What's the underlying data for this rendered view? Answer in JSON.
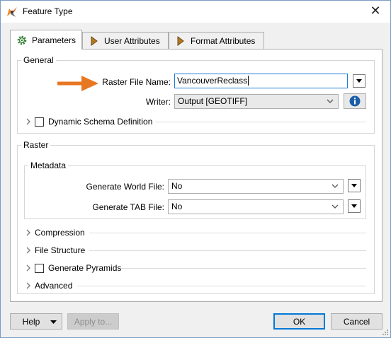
{
  "window": {
    "title": "Feature Type",
    "close_label": "✕"
  },
  "tabs": [
    {
      "label": "Parameters",
      "icon": "gear-icon",
      "active": true
    },
    {
      "label": "User Attributes",
      "icon": "arrow-right-icon",
      "active": false
    },
    {
      "label": "Format Attributes",
      "icon": "arrow-right-icon",
      "active": false
    }
  ],
  "general": {
    "title": "General",
    "raster_file_name_label": "Raster File Name:",
    "raster_file_name_value": "VancouverReclass",
    "writer_label": "Writer:",
    "writer_value": "Output [GEOTIFF]",
    "dynamic_schema_label": "Dynamic Schema Definition"
  },
  "raster": {
    "title": "Raster",
    "metadata_title": "Metadata",
    "generate_world_file_label": "Generate World File:",
    "generate_world_file_value": "No",
    "generate_tab_file_label": "Generate TAB File:",
    "generate_tab_file_value": "No",
    "sections": {
      "compression": "Compression",
      "file_structure": "File Structure",
      "generate_pyramids": "Generate Pyramids",
      "advanced": "Advanced"
    }
  },
  "footer": {
    "help_label": "Help",
    "apply_label": "Apply to...",
    "ok_label": "OK",
    "cancel_label": "Cancel"
  },
  "colors": {
    "annotation_arrow": "#e87722",
    "focus_blue": "#1e7ad8",
    "info_blue": "#1b5ea8"
  }
}
